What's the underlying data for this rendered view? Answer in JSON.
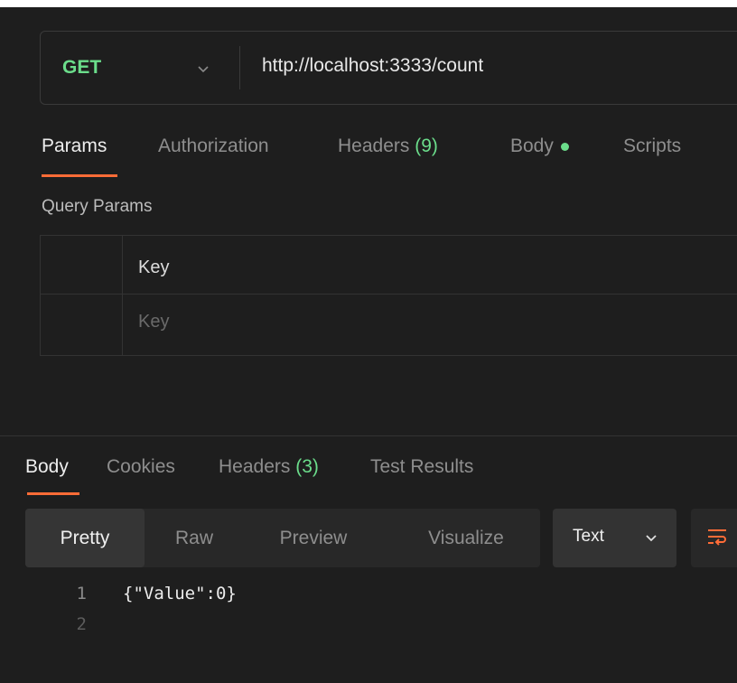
{
  "request": {
    "method": "GET",
    "url": "http://localhost:3333/count"
  },
  "request_tabs": {
    "params": "Params",
    "authorization": "Authorization",
    "headers_label": "Headers",
    "headers_count": "(9)",
    "body": "Body",
    "scripts": "Scripts"
  },
  "query_params": {
    "title": "Query Params",
    "key_header": "Key",
    "key_placeholder": "Key"
  },
  "response_tabs": {
    "body": "Body",
    "cookies": "Cookies",
    "headers_label": "Headers",
    "headers_count": "(3)",
    "test_results": "Test Results"
  },
  "format": {
    "pretty": "Pretty",
    "raw": "Raw",
    "preview": "Preview",
    "visualize": "Visualize",
    "type": "Text"
  },
  "code": [
    {
      "line": "1",
      "text": "{\"Value\":0}"
    },
    {
      "line": "2",
      "text": ""
    }
  ],
  "colors": {
    "background": "#1e1e1e",
    "method_green": "#6bdd8b",
    "accent_orange": "#ff6c37"
  },
  "icons": {
    "method_dropdown": "chevron-down-icon",
    "body_indicator": "green-dot-icon",
    "format_dropdown": "chevron-down-icon",
    "wrap": "wrap-lines-icon"
  }
}
